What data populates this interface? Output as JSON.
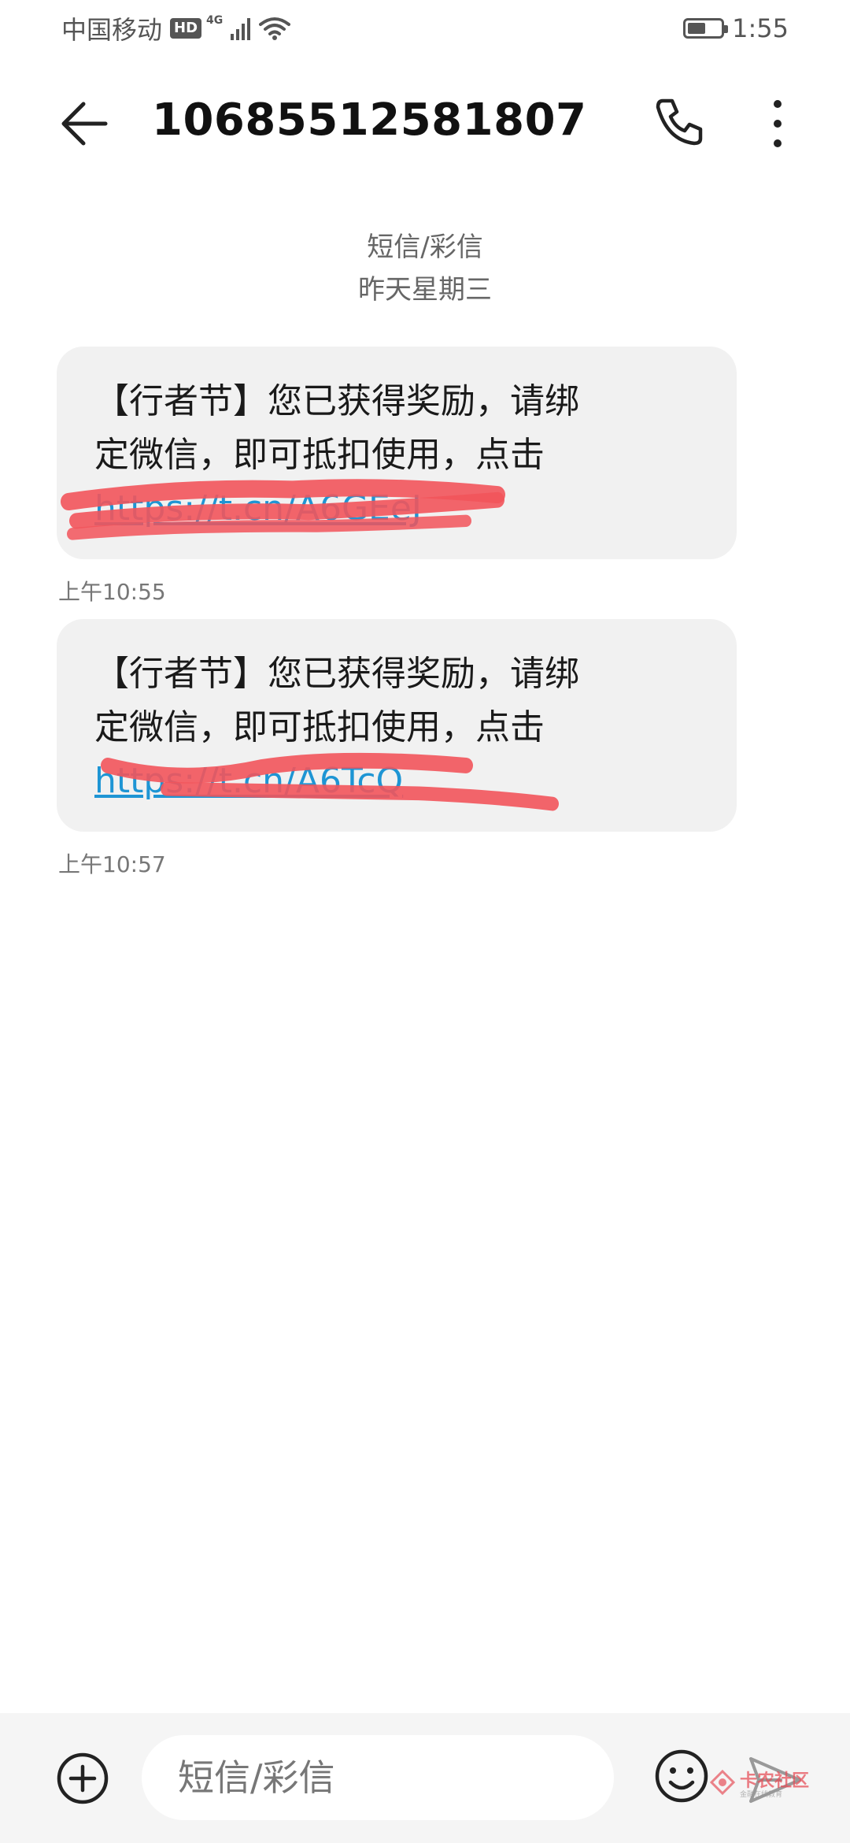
{
  "status_bar": {
    "carrier": "中国移动",
    "hd_badge": "HD",
    "network": "4G",
    "time": "1:55",
    "battery_level": 0.55
  },
  "header": {
    "title": "10685512581807",
    "back_icon": "back-arrow-icon",
    "call_icon": "phone-icon",
    "more_icon": "more-vertical-icon"
  },
  "conversation": {
    "type_label": "短信/彩信",
    "date_label": "昨天星期三"
  },
  "messages": [
    {
      "line1": "【行者节】您已获得奖励，请绑",
      "line2": "定微信，即可抵扣使用，点击",
      "link": "https://t.cn/A6GEeJ",
      "time": "上午10:55"
    },
    {
      "line1": "【行者节】您已获得奖励，请绑",
      "line2": "定微信，即可抵扣使用，点击",
      "link": "https://t.cn/A6TcQ",
      "time": "上午10:57"
    }
  ],
  "composer": {
    "placeholder": "短信/彩信",
    "add_icon": "plus-circle-icon",
    "emoji_icon": "emoji-icon",
    "send_icon": "send-icon"
  },
  "watermark": {
    "text": "卡农社区",
    "subtext": "金融在线教育"
  },
  "colors": {
    "link": "#1e95d4",
    "bubble_bg": "#f1f1f1",
    "scribble": "#f2545b"
  }
}
